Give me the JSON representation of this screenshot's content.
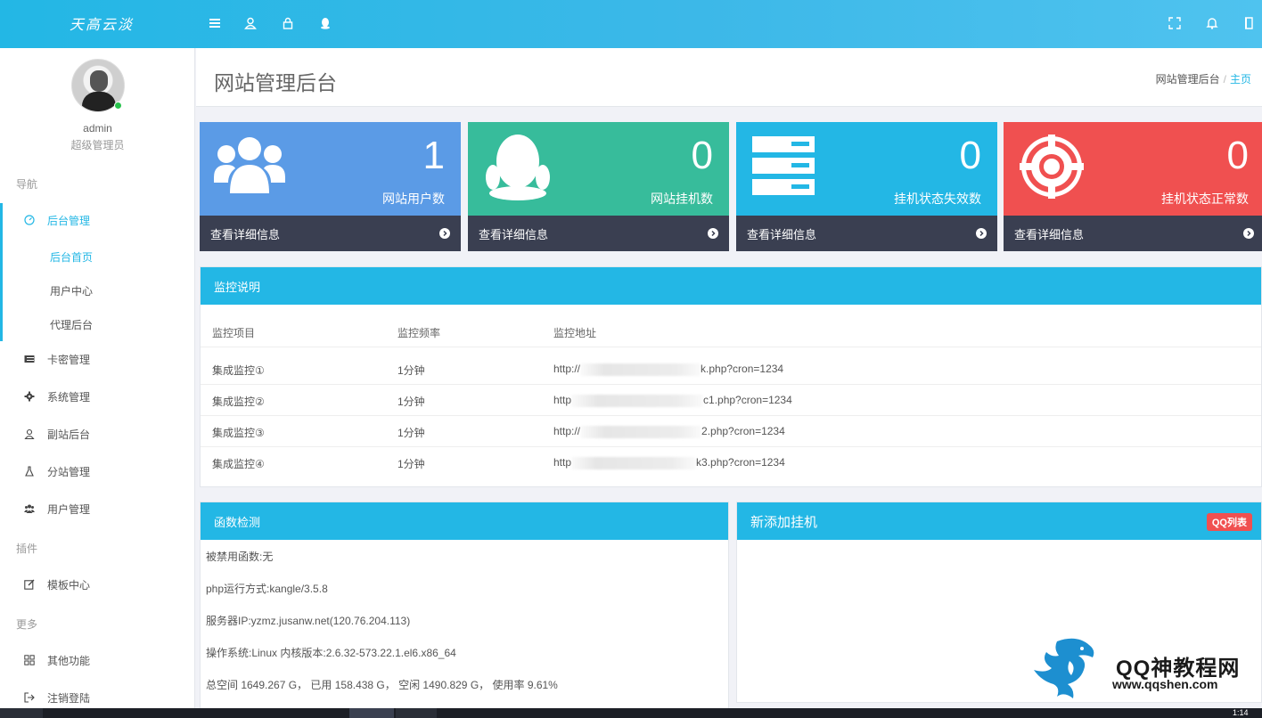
{
  "topbar": {
    "brand": "天高云淡",
    "left_icons": [
      "menu-icon",
      "user-icon",
      "lock-icon",
      "qq-icon"
    ],
    "right_icons": [
      "fullscreen-icon",
      "bell-icon",
      "logout-icon"
    ]
  },
  "sidebar": {
    "user": {
      "name": "admin",
      "role": "超级管理员"
    },
    "sections": {
      "nav": "导航",
      "plugins": "插件",
      "more": "更多"
    },
    "menu": {
      "backend": "后台管理",
      "backend_sub": [
        "后台首页",
        "用户中心",
        "代理后台"
      ],
      "card_admin": "卡密管理",
      "system_admin": "系统管理",
      "substation_backend": "副站后台",
      "branch_admin": "分站管理",
      "user_admin": "用户管理",
      "template_center": "模板中心",
      "other_functions": "其他功能",
      "logout": "注销登陆"
    }
  },
  "header": {
    "title": "网站管理后台",
    "breadcrumb": {
      "current": "网站管理后台",
      "separator": "/",
      "home": "主页"
    }
  },
  "cards": [
    {
      "value": "1",
      "label": "网站用户数",
      "link": "查看详细信息",
      "color": "#5b9be6",
      "icon": "users-icon"
    },
    {
      "value": "0",
      "label": "网站挂机数",
      "link": "查看详细信息",
      "color": "#37bc9b",
      "icon": "qq-icon"
    },
    {
      "value": "0",
      "label": "挂机状态失效数",
      "link": "查看详细信息",
      "color": "#23b7e5",
      "icon": "server-icon"
    },
    {
      "value": "0",
      "label": "挂机状态正常数",
      "link": "查看详细信息",
      "color": "#f05050",
      "icon": "lifebuoy-icon"
    }
  ],
  "monitor": {
    "title": "监控说明",
    "columns": [
      "监控项目",
      "监控频率",
      "监控地址"
    ],
    "rows": [
      {
        "item": "集成监控①",
        "freq": "1分钟",
        "url_prefix": "http://",
        "url_suffix": "k.php?cron=1234"
      },
      {
        "item": "集成监控②",
        "freq": "1分钟",
        "url_prefix": "http",
        "url_suffix": "c1.php?cron=1234"
      },
      {
        "item": "集成监控③",
        "freq": "1分钟",
        "url_prefix": "http://",
        "url_suffix": "2.php?cron=1234"
      },
      {
        "item": "集成监控④",
        "freq": "1分钟",
        "url_prefix": "http",
        "url_suffix": "k3.php?cron=1234"
      }
    ]
  },
  "functions": {
    "title": "函数检测",
    "lines": [
      "被禁用函数:无",
      "php运行方式:kangle/3.5.8",
      "服务器IP:yzmz.jusanw.net(120.76.204.113)",
      "操作系统:Linux  内核版本:2.6.32-573.22.1.el6.x86_64",
      "总空间 1649.267 G， 已用 158.438 G， 空闲 1490.829 G， 使用率 9.61%"
    ]
  },
  "new_hangup": {
    "title": "新添加挂机",
    "tag": "QQ列表"
  },
  "watermark": {
    "line1": "QQ神教程网",
    "line2": "www.qqshen.com"
  },
  "taskbar": {
    "time": "1:14"
  }
}
